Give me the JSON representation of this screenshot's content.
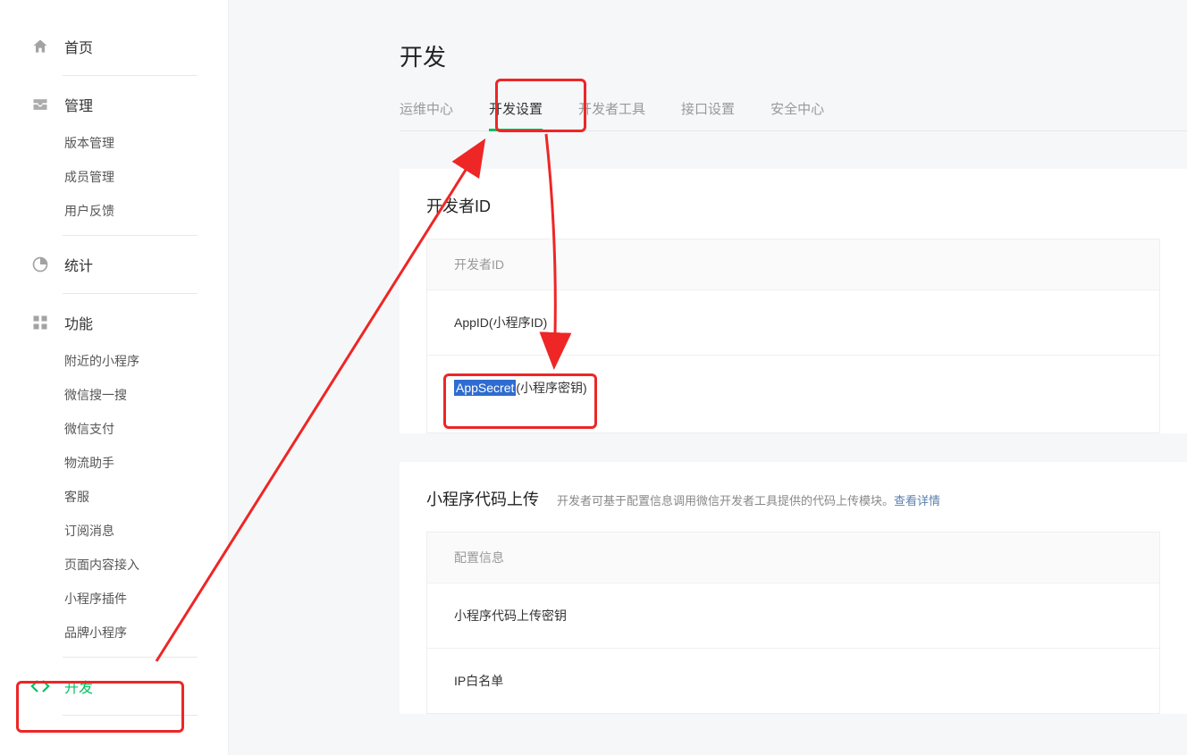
{
  "sidebar": {
    "home": "首页",
    "manage": "管理",
    "manage_items": [
      "版本管理",
      "成员管理",
      "用户反馈"
    ],
    "stats": "统计",
    "features": "功能",
    "feature_items": [
      "附近的小程序",
      "微信搜一搜",
      "微信支付",
      "物流助手",
      "客服",
      "订阅消息",
      "页面内容接入",
      "小程序插件",
      "品牌小程序"
    ],
    "develop": "开发"
  },
  "page": {
    "title": "开发"
  },
  "tabs": [
    "运维中心",
    "开发设置",
    "开发者工具",
    "接口设置",
    "安全中心"
  ],
  "devid": {
    "section_title": "开发者ID",
    "panel_head": "开发者ID",
    "appid_label": "AppID(小程序ID)",
    "appsecret_hl": "AppSecret",
    "appsecret_rest": "(小程序密钥)"
  },
  "upload": {
    "section_title": "小程序代码上传",
    "desc_text": "开发者可基于配置信息调用微信开发者工具提供的代码上传模块。",
    "desc_link": "查看详情",
    "panel_head": "配置信息",
    "row1": "小程序代码上传密钥",
    "row2": "IP白名单"
  }
}
